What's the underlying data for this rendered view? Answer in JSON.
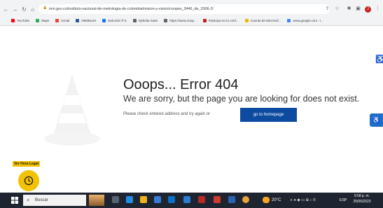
{
  "browser": {
    "url": "inm.gov.co/instituto-nacional-de-metrologia-de-colombia/mision-y-vision/conpes_3446_de_2006-2/",
    "avatar_letter": "J",
    "bookmarks": [
      {
        "label": "YouTube",
        "color": "#ff0000"
      },
      {
        "label": "Maps",
        "color": "#34a853"
      },
      {
        "label": "Gmail",
        "color": "#ea4335"
      },
      {
        "label": "INMiNoret",
        "color": "#2b579a"
      },
      {
        "label": "Isolución ® 5",
        "color": "#1a73e8"
      },
      {
        "label": "Ophelia Suite",
        "color": "#5f6368"
      },
      {
        "label": "https://www.zoop...",
        "color": "#5f6368"
      },
      {
        "label": "Participa en la conf...",
        "color": "#c5221f"
      },
      {
        "label": "Cuenta de Microsof...",
        "color": "#f4b400"
      },
      {
        "label": "www.google.com - i...",
        "color": "#4285f4"
      }
    ]
  },
  "page": {
    "title": "Ooops... Error 404",
    "subtitle": "We are sorry, but the page you are looking for does not exist.",
    "hint": "Please check entered address and try again or",
    "home_button": "go to homepage",
    "hora_legal": "Ver Hora Legal",
    "accent": "#0d4ba0",
    "yellow": "#f3c200"
  },
  "taskbar": {
    "search_placeholder": "Buscar",
    "weather": "20°C",
    "language": "ESP",
    "time": "9:58 p. m.",
    "date": "25/06/2023"
  }
}
